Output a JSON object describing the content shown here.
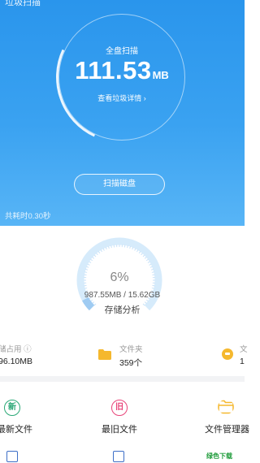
{
  "header": {
    "partial_title": "垃圾扫描"
  },
  "scan_summary": {
    "label": "全盘扫描",
    "size_value": "111.53",
    "size_unit": "MB",
    "details_link": "查看垃圾详情 ›",
    "scan_button": "扫描磁盘",
    "elapsed": "共耗时0.30秒"
  },
  "storage": {
    "percent_text": "6%",
    "usage_fraction": 0.06,
    "usage_text": "987.55MB / 15.62GB",
    "label": "存储分析"
  },
  "stats": [
    {
      "label": "储占用 ⓘ",
      "value": "96.10MB"
    },
    {
      "label": "文件夹",
      "value": "359个"
    },
    {
      "label": "文",
      "value": "1"
    }
  ],
  "tools": [
    {
      "label": "最新文件",
      "icon": "new-file-icon",
      "glyph": "新",
      "color": "#2aa876"
    },
    {
      "label": "最旧文件",
      "icon": "old-file-icon",
      "glyph": "旧",
      "color": "#e8457a"
    },
    {
      "label": "文件管理器",
      "icon": "folder-icon",
      "color": "#f5b82e"
    }
  ],
  "watermark": "绿色下载",
  "colors": {
    "header_blue": "#2a95ec",
    "gauge_track": "#d6ebfb",
    "gauge_fill": "#9fcbf2"
  }
}
